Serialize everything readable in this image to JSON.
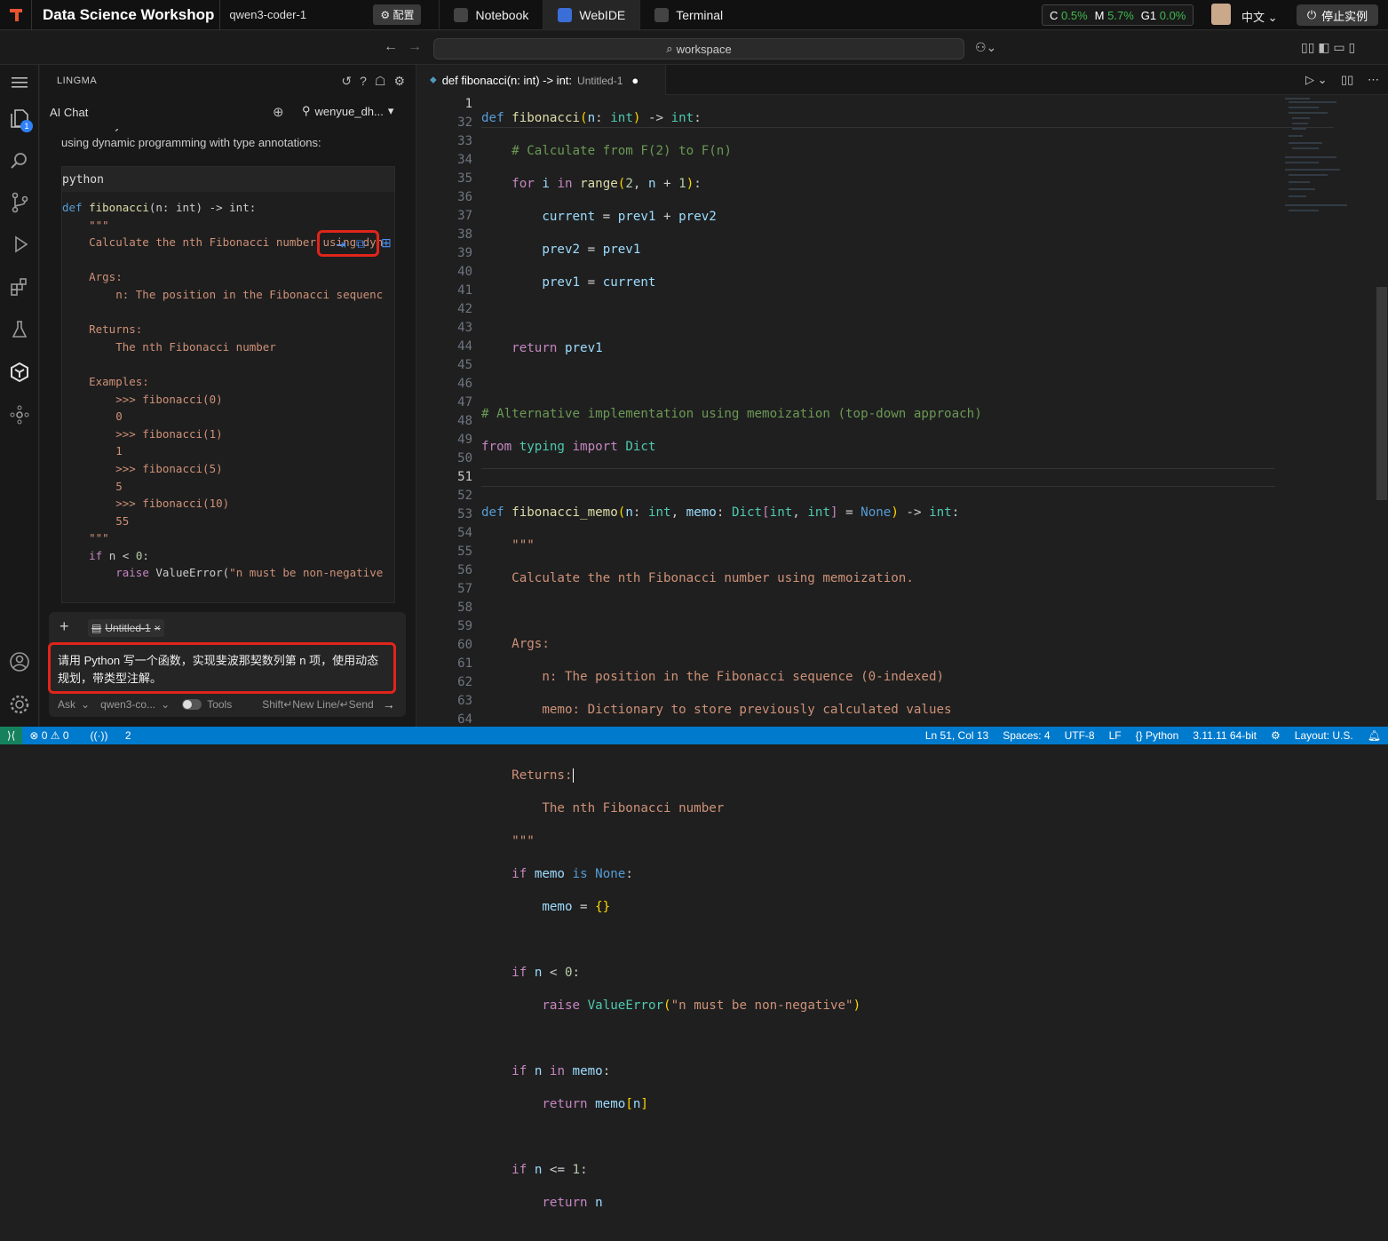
{
  "topbar": {
    "app_title": "Data Science Workshop",
    "instance": "qwen3-coder-1",
    "config_label": "⚙ 配置",
    "tabs": [
      {
        "label": "Notebook",
        "active": false
      },
      {
        "label": "WebIDE",
        "active": true
      },
      {
        "label": "Terminal",
        "active": false
      }
    ],
    "metrics": {
      "c_label": "C",
      "c_value": "0.5%",
      "m_label": "M",
      "m_value": "5.7%",
      "g_label": "G1",
      "g_value": "0.0%"
    },
    "language": "中文 ⌄",
    "stop_label": "停止实例"
  },
  "commandbar": {
    "search_text": "workspace"
  },
  "sidebar": {
    "header": "LINGMA",
    "chat_title": "AI Chat",
    "user": "wenyue_dh...",
    "message": "Here's a Python function that calculates the nth Fibonacci number using dynamic programming with type annotations:",
    "code_lang": "python",
    "composer": {
      "context_file": "Untitled-1",
      "prompt": "请用 Python 写一个函数，实现斐波那契数列第 n 项，使用动态规划，带类型注解。",
      "mode": "Ask",
      "model": "qwen3-co...",
      "tools": "Tools",
      "hint": "Shift↵New Line/↵Send"
    }
  },
  "editor": {
    "tab_title": "def fibonacci(n: int) -> int:",
    "tab_file": "Untitled-1",
    "sticky_line_number": "1",
    "line_numbers": [
      "32",
      "33",
      "34",
      "35",
      "36",
      "37",
      "38",
      "39",
      "40",
      "41",
      "42",
      "43",
      "44",
      "45",
      "46",
      "47",
      "48",
      "49",
      "50",
      "51",
      "52",
      "53",
      "54",
      "55",
      "56",
      "57",
      "58",
      "59",
      "60",
      "61",
      "62",
      "63",
      "64"
    ]
  },
  "statusbar": {
    "errors": "⊗ 0 ⚠ 0",
    "ports": "2",
    "position": "Ln 51, Col 13",
    "spaces": "Spaces: 4",
    "encoding": "UTF-8",
    "eol": "LF",
    "language": "{} Python",
    "interpreter": "3.11.11 64-bit",
    "layout": "Layout: U.S."
  }
}
